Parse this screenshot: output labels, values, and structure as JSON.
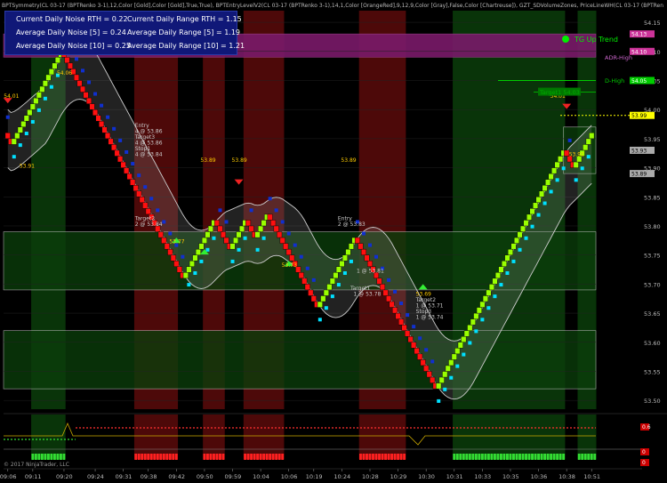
{
  "header_text": "BPTSymmetry(CL 03-17 (BPTRenko 3-1),12,Color [Gold],Color [Gold],True,True), BPTEntryLevelV2(CL 03-17 (BPTRenko 3-1),14,1,Color [OrangeRed],9,12,9,Color [Gray],False,Color [Chartreuse]), GZT_SDVolumeZones, PriceLineWH(CL 03-17 (BPTRen",
  "stats": [
    {
      "label": "Current Daily Noise RTH = 0.22"
    },
    {
      "label": "Current Daily Range RTH = 1.15"
    },
    {
      "label": "Average Daily Noise [5] = 0.24"
    },
    {
      "label": "Average Daily Range [5] = 1.19"
    },
    {
      "label": "Average Daily Noise [10] = 0.25"
    },
    {
      "label": "Average Daily Range [10] = 1.21"
    }
  ],
  "trend_label": "TG Up Trend",
  "copyright": "© 2017 NinjaTrader, LLC",
  "colors": {
    "up_bar": "#99ff00",
    "down_bar": "#ff1010",
    "red_zone": "#5a0a0a",
    "green_zone": "#0b3d0b",
    "supply": "#7a1a6a",
    "channel": "#cccccc",
    "bid_marker": "#00e0ff",
    "ask_marker": "#1030d0"
  },
  "chart_data": {
    "type": "candlestick",
    "instrument": "CL 03-17 (BPTRenko 3-1)",
    "y_axis": {
      "ylim": [
        53.485,
        54.17
      ],
      "ticks": [
        {
          "value": 54.15,
          "label": "54.15"
        },
        {
          "value": 54.1,
          "label": "54.10"
        },
        {
          "value": 54.05,
          "label": "54.05"
        },
        {
          "value": 54.0,
          "label": "54.00"
        },
        {
          "value": 53.95,
          "label": "53.95"
        },
        {
          "value": 53.9,
          "label": "53.90"
        },
        {
          "value": 53.85,
          "label": "53.85"
        },
        {
          "value": 53.8,
          "label": "53.80"
        },
        {
          "value": 53.75,
          "label": "53.75"
        },
        {
          "value": 53.7,
          "label": "53.70"
        },
        {
          "value": 53.65,
          "label": "53.65"
        },
        {
          "value": 53.6,
          "label": "53.60"
        },
        {
          "value": 53.55,
          "label": "53.55"
        },
        {
          "value": 53.5,
          "label": "53.50"
        }
      ]
    },
    "x_axis": {
      "ticks": [
        {
          "bar": 0,
          "label": "09:06"
        },
        {
          "bar": 8,
          "label": "09:11"
        },
        {
          "bar": 18,
          "label": "09:20"
        },
        {
          "bar": 28,
          "label": "09:24"
        },
        {
          "bar": 37,
          "label": "09:31"
        },
        {
          "bar": 45,
          "label": "09:38"
        },
        {
          "bar": 54,
          "label": "09:42"
        },
        {
          "bar": 63,
          "label": "09:50"
        },
        {
          "bar": 72,
          "label": "09:59"
        },
        {
          "bar": 81,
          "label": "10:04"
        },
        {
          "bar": 90,
          "label": "10:06"
        },
        {
          "bar": 98,
          "label": "10:19"
        },
        {
          "bar": 107,
          "label": "10:24"
        },
        {
          "bar": 116,
          "label": "10:28"
        },
        {
          "bar": 125,
          "label": "10:29"
        },
        {
          "bar": 134,
          "label": "10:30"
        },
        {
          "bar": 143,
          "label": "10:31"
        },
        {
          "bar": 152,
          "label": "10:33"
        },
        {
          "bar": 161,
          "label": "10:35"
        },
        {
          "bar": 170,
          "label": "10:36"
        },
        {
          "bar": 179,
          "label": "10:38"
        },
        {
          "bar": 188,
          "label": "10:51"
        }
      ]
    },
    "renko_path": [
      {
        "bars": 2,
        "delta": -0.01
      },
      {
        "bars": 16,
        "delta": 0.01
      },
      {
        "bars": 2,
        "delta": -0.01
      },
      {
        "bars": 9,
        "delta": -0.01
      },
      {
        "bars": 28,
        "delta": -0.01
      },
      {
        "bars": 10,
        "delta": 0.01
      },
      {
        "bars": 5,
        "delta": -0.01
      },
      {
        "bars": 5,
        "delta": 0.01
      },
      {
        "bars": 3,
        "delta": -0.01
      },
      {
        "bars": 4,
        "delta": 0.01
      },
      {
        "bars": 16,
        "delta": -0.01
      },
      {
        "bars": 12,
        "delta": 0.01
      },
      {
        "bars": 26,
        "delta": -0.01
      },
      {
        "bars": 4,
        "delta": 0.01
      },
      {
        "bars": 37,
        "delta": 0.01
      },
      {
        "bars": 3,
        "delta": -0.01
      },
      {
        "bars": 6,
        "delta": 0.01
      }
    ],
    "start_price": 53.96,
    "price_levels": [
      {
        "label": "54.13",
        "value": 54.13,
        "color": "#cc3399"
      },
      {
        "label": "54.10",
        "value": 54.1,
        "color": "#cc3399"
      },
      {
        "label": "ADR-High",
        "value": 54.09,
        "color": "#cc66cc"
      },
      {
        "label": "54.05",
        "value": 54.05,
        "color": "#00cc00"
      },
      {
        "label": "D-High",
        "value": 54.05,
        "color": "#00cc00"
      },
      {
        "label": "Target1 54.03",
        "value": 54.03,
        "color": "#00aa00"
      },
      {
        "label": "53.99",
        "value": 53.99,
        "color": "#ffff00"
      },
      {
        "label": "53.93",
        "value": 53.93,
        "color": "#888888"
      },
      {
        "label": "53.89",
        "value": 53.89,
        "color": "#888888"
      }
    ],
    "zones": [
      {
        "type": "supply",
        "top": 54.13,
        "bottom": 54.09,
        "color": "#7a1a6a"
      },
      {
        "type": "demand",
        "top": 53.79,
        "bottom": 53.69,
        "color": "#0b3d0b"
      },
      {
        "type": "demand",
        "top": 53.62,
        "bottom": 53.52,
        "color": "#0b3d0b"
      },
      {
        "type": "demand",
        "top": 53.97,
        "bottom": 53.89,
        "color": "#0b3d0b"
      }
    ],
    "session_bands": [
      {
        "from": 8,
        "to": 18,
        "color": "green"
      },
      {
        "from": 41,
        "to": 54,
        "color": "red"
      },
      {
        "from": 63,
        "to": 69,
        "color": "red"
      },
      {
        "from": 76,
        "to": 88,
        "color": "red"
      },
      {
        "from": 113,
        "to": 127,
        "color": "red"
      },
      {
        "from": 143,
        "to": 178,
        "color": "green"
      },
      {
        "from": 183,
        "to": 188,
        "color": "green"
      }
    ],
    "labels": [
      {
        "text": "54.01",
        "bar": 1,
        "value": 54.02
      },
      {
        "text": "54.06",
        "bar": 18,
        "value": 54.06
      },
      {
        "text": "53.91",
        "bar": 6,
        "value": 53.9
      },
      {
        "text": "Entry",
        "bar": 43,
        "value": 53.97
      },
      {
        "text": "4 @ 53.86",
        "bar": 43,
        "value": 53.96
      },
      {
        "text": "Target3",
        "bar": 43,
        "value": 53.95
      },
      {
        "text": "4 @ 53.86",
        "bar": 43,
        "value": 53.94
      },
      {
        "text": "Stop1",
        "bar": 43,
        "value": 53.93
      },
      {
        "text": "4 @ 53.84",
        "bar": 43,
        "value": 53.92
      },
      {
        "text": "Target2",
        "bar": 43,
        "value": 53.81
      },
      {
        "text": "2 @ 53.84",
        "bar": 43,
        "value": 53.8
      },
      {
        "text": "53.77",
        "bar": 54,
        "value": 53.77
      },
      {
        "text": "53.89",
        "bar": 64,
        "value": 53.91
      },
      {
        "text": "53.89",
        "bar": 74,
        "value": 53.91
      },
      {
        "text": "53.73",
        "bar": 90,
        "value": 53.73
      },
      {
        "text": "53.89",
        "bar": 109,
        "value": 53.91
      },
      {
        "text": "Entry",
        "bar": 108,
        "value": 53.81
      },
      {
        "text": "2 @ 53.83",
        "bar": 108,
        "value": 53.8
      },
      {
        "text": "1 @ 53.81",
        "bar": 114,
        "value": 53.72
      },
      {
        "text": "Target1",
        "bar": 112,
        "value": 53.69
      },
      {
        "text": "1 @ 53.78",
        "bar": 113,
        "value": 53.68
      },
      {
        "text": "53.69",
        "bar": 133,
        "value": 53.68
      },
      {
        "text": "Target2",
        "bar": 133,
        "value": 53.67
      },
      {
        "text": "1 @ 53.71",
        "bar": 133,
        "value": 53.66
      },
      {
        "text": "Stop3",
        "bar": 133,
        "value": 53.65
      },
      {
        "text": "1 @ 53.74",
        "bar": 133,
        "value": 53.64
      },
      {
        "text": "54.01",
        "bar": 176,
        "value": 54.02
      },
      {
        "text": "53.92",
        "bar": 182,
        "value": 53.92
      }
    ],
    "lower_panel": {
      "right_labels": [
        "0.6",
        "0",
        "0"
      ]
    }
  }
}
